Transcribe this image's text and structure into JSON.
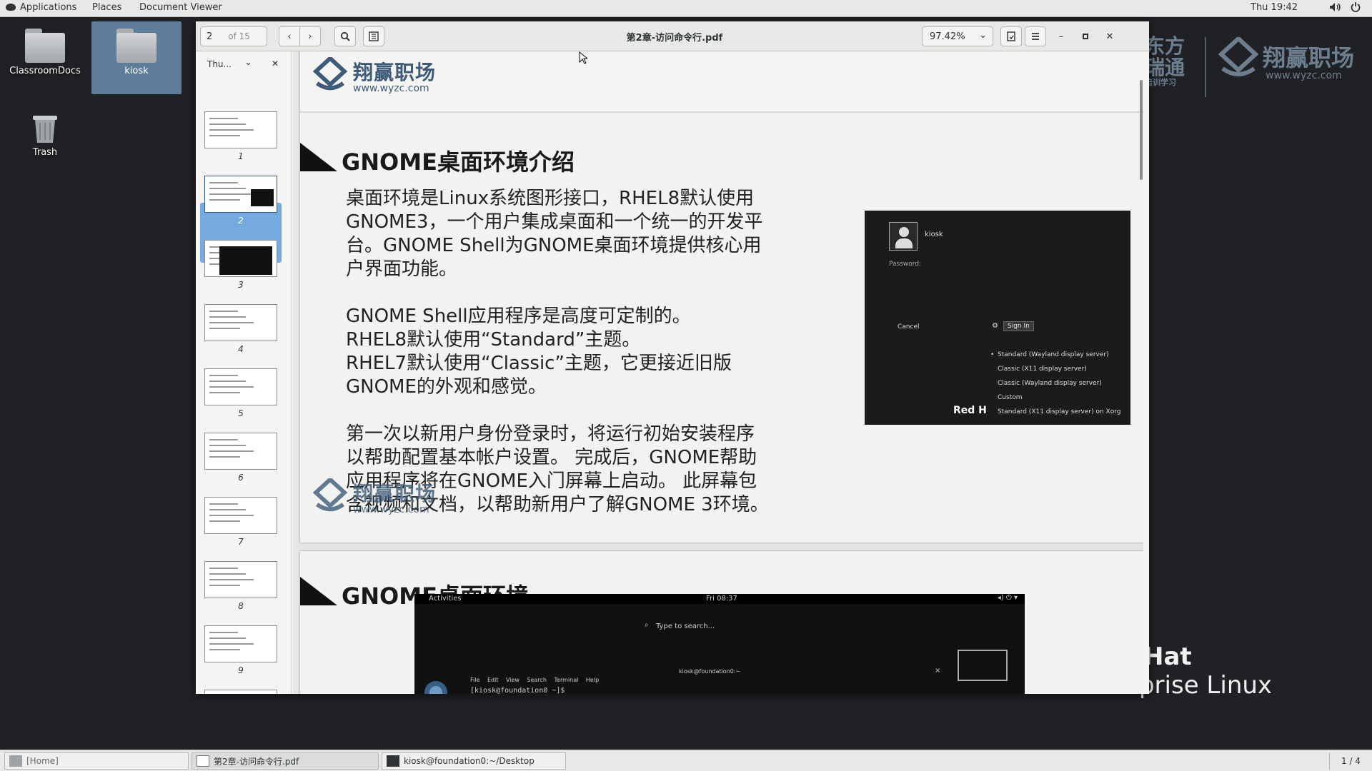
{
  "topbar": {
    "applications": "Applications",
    "places": "Places",
    "document_viewer": "Document Viewer",
    "clock": "Thu 19:42"
  },
  "desktop": {
    "icons": [
      {
        "label": "ClassroomDocs"
      },
      {
        "label": "kiosk"
      },
      {
        "label": "Trash"
      }
    ],
    "brand_left": "东方\n瑞通",
    "brand_left_small": "培训学习",
    "brand_right_cn": "翔赢职场",
    "brand_right_url": "www.wyzc.com",
    "redhat_line1": "Hat",
    "redhat_line2": "rprise Linux"
  },
  "viewer": {
    "page_current": "2",
    "page_total": "of 15",
    "title": "第2章-访问命令行.pdf",
    "zoom": "97.42%",
    "sidebar_mode": "Thu...",
    "thumbnails": [
      "1",
      "2",
      "3",
      "4",
      "5",
      "6",
      "7",
      "8",
      "9"
    ]
  },
  "page1": {
    "watermark_cn": "翔赢职场",
    "watermark_url": "www.wyzc.com",
    "title": "GNOME桌面环境介绍",
    "para1_l1": "桌面环境是Linux系统图形接口，RHEL8默认使用",
    "para1_l2": "GNOME3，一个用户集成桌面和一个统一的开发平",
    "para1_l3": "台。GNOME Shell为GNOME桌面环境提供核心用",
    "para1_l4": "户界面功能。",
    "para2_l1": "GNOME Shell应用程序是高度可定制的。",
    "para2_l2": "RHEL8默认使用“Standard”主题。",
    "para2_l3": "RHEL7默认使用“Classic”主题，它更接近旧版",
    "para2_l4": "GNOME的外观和感觉。",
    "para3_l1": "第一次以新用户身份登录时，将运行初始安装程序",
    "para3_l2": "以帮助配置基本帐户设置。 完成后，GNOME帮助",
    "para3_l3": "应用程序将在GNOME入门屏幕上启动。 此屏幕包",
    "para3_l4": "含视频和文档，以帮助新用户了解GNOME 3环境。",
    "login": {
      "user": "kiosk",
      "password_label": "Password:",
      "cancel": "Cancel",
      "sign_in": "Sign In",
      "options": [
        "Standard (Wayland display server)",
        "Classic (X11 display server)",
        "Classic (Wayland display server)",
        "Custom",
        "Standard (X11 display server) on Xorg"
      ],
      "brand": "Red H"
    }
  },
  "page2": {
    "title": "GNOME桌面环境",
    "shell": {
      "activities": "Activities",
      "clock": "Fri 08:37",
      "search_placeholder": "Type to search...",
      "terminal_title": "kiosk@foundation0:~",
      "menu": [
        "File",
        "Edit",
        "View",
        "Search",
        "Terminal",
        "Help"
      ],
      "prompt": "[kiosk@foundation0 ~]$"
    }
  },
  "taskbar": {
    "home": "[Home]",
    "pdf": "第2章-访问命令行.pdf",
    "terminal": "kiosk@foundation0:~/Desktop",
    "workspace": "1 / 4"
  },
  "colors": {
    "panel": "#e8e8e7",
    "desktop": "#1f2124",
    "selection": "#4a90d9",
    "watermark": "#3e5b7a"
  }
}
